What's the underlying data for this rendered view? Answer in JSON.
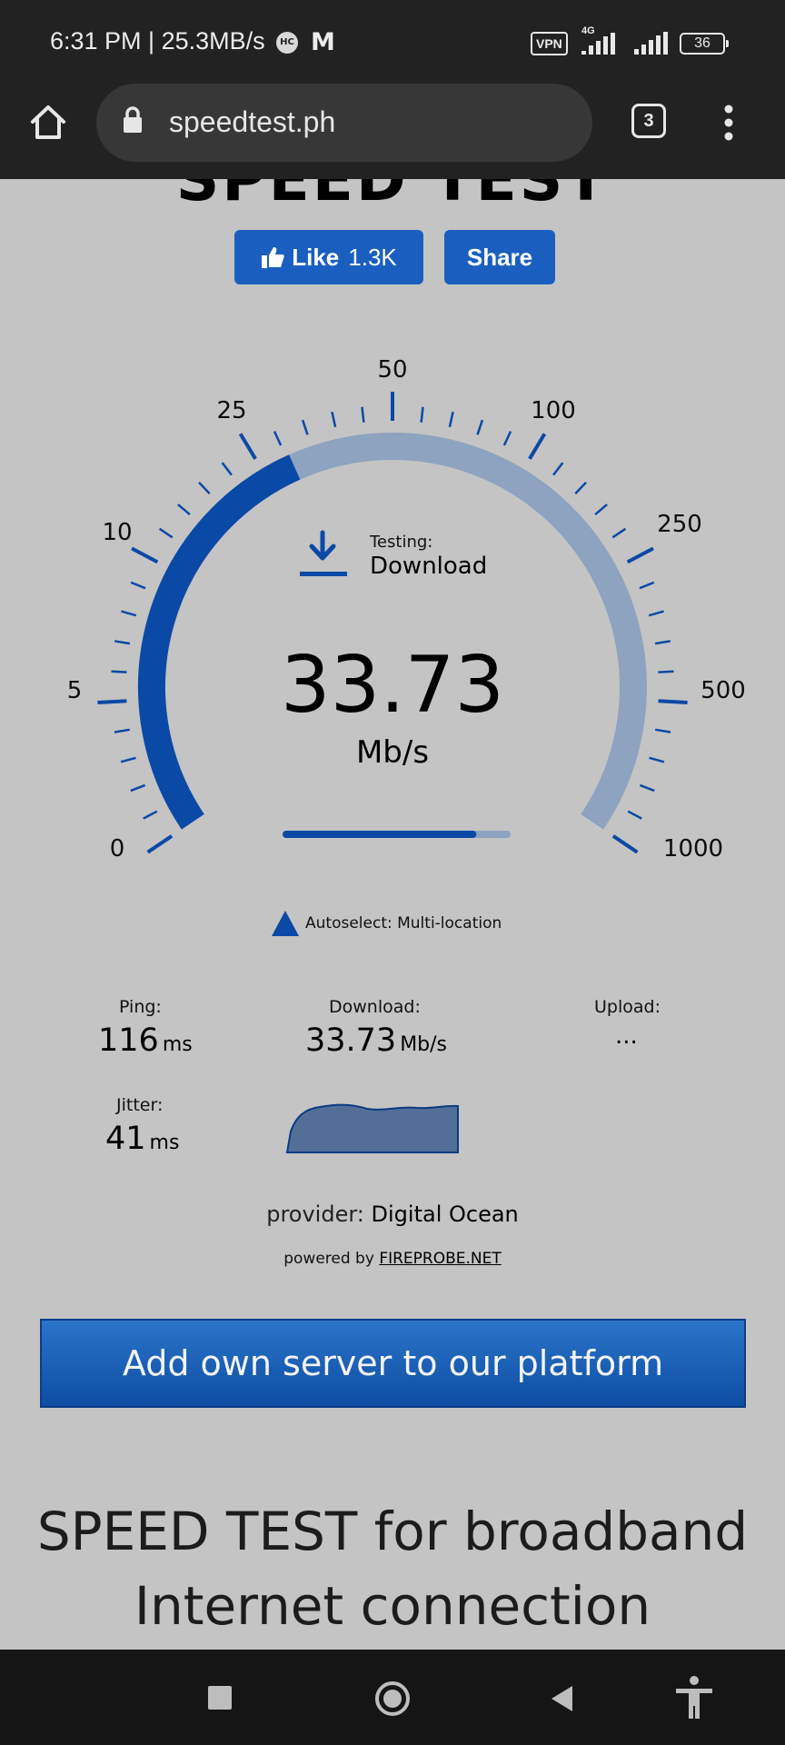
{
  "status_bar": {
    "time": "6:31 PM | 25.3MB/s",
    "hc_badge": "HC",
    "m_icon": "M",
    "vpn": "VPN",
    "network": "4G",
    "battery": "36"
  },
  "browser": {
    "url": "speedtest.ph",
    "tab_count": "3"
  },
  "page": {
    "heading_partial": "SPEED TEST",
    "like": {
      "label": "Like",
      "count": "1.3K"
    },
    "share_label": "Share",
    "gauge": {
      "ticks": [
        "0",
        "5",
        "10",
        "25",
        "50",
        "100",
        "250",
        "500",
        "1000"
      ],
      "testing_label": "Testing:",
      "testing_value": "Download",
      "speed": "33.73",
      "unit": "Mb/s",
      "progress": 0.85
    },
    "autoselect": "Autoselect: Multi-location",
    "stats": {
      "ping_label": "Ping:",
      "ping_value": "116",
      "ping_unit": "ms",
      "download_label": "Download:",
      "download_value": "33.73",
      "download_unit": "Mb/s",
      "upload_label": "Upload:",
      "upload_value": "...",
      "jitter_label": "Jitter:",
      "jitter_value": "41",
      "jitter_unit": "ms"
    },
    "provider_label": "provider:",
    "provider_name": "Digital Ocean",
    "powered_label": "powered by",
    "powered_link": "FIREPROBE.NET",
    "add_server": "Add own server to our platform",
    "title_line1": "SPEED TEST for broadband",
    "title_line2": "Internet connection"
  },
  "colors": {
    "accent": "#1a5fc0",
    "arc_active": "#0b49a6",
    "arc_rest": "#8da3bf",
    "background": "#c4c4c4"
  }
}
